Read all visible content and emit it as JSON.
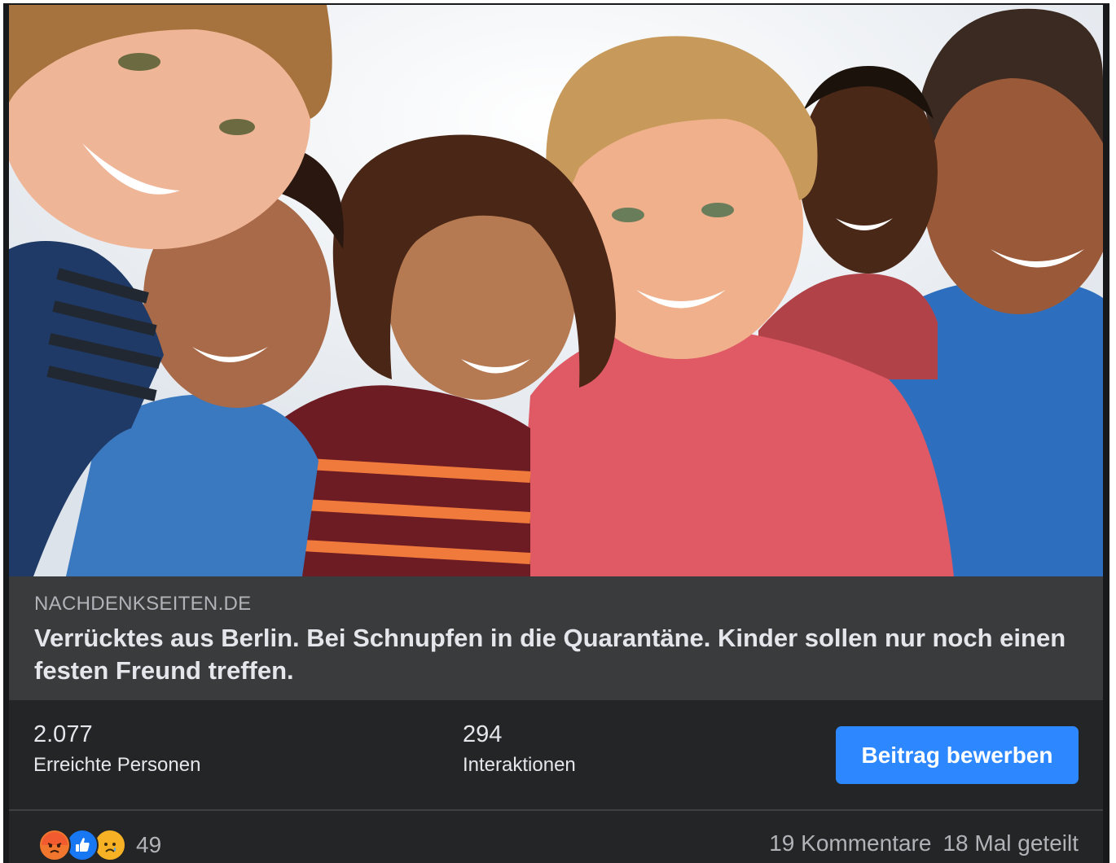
{
  "post": {
    "image_alt": "Group of smiling children",
    "link": {
      "domain": "NACHDENKSEITEN.DE",
      "title": "Verrücktes aus Berlin. Bei Schnupfen in die Quarantäne. Kinder sollen nur noch einen festen Freund treffen."
    },
    "insights": {
      "reach_value": "2.077",
      "reach_label": "Erreichte Personen",
      "engagement_value": "294",
      "engagement_label": "Interaktionen"
    },
    "boost_label": "Beitrag bewerben",
    "reactions": {
      "icons": [
        "angry-icon",
        "like-icon",
        "sad-icon"
      ],
      "count": "49"
    },
    "comments_label": "19 Kommentare",
    "shares_label": "18 Mal geteilt"
  },
  "colors": {
    "background": "#242526",
    "link_box": "#3a3b3c",
    "accent": "#2d88ff",
    "text_primary": "#e4e6eb",
    "text_secondary": "#b0b3b8"
  }
}
